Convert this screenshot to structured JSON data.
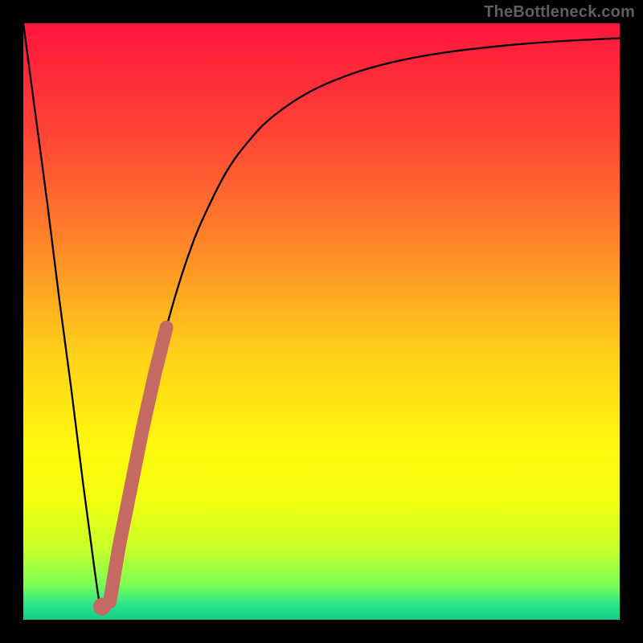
{
  "attribution": "TheBottleneck.com",
  "colors": {
    "frame": "#000000",
    "attribution_text": "#5f5f5f",
    "curve": "#000000",
    "overlay_stroke": "#c46a63",
    "gradient_stops": [
      {
        "offset": 0.0,
        "color": "#ff163d"
      },
      {
        "offset": 0.18,
        "color": "#ff4236"
      },
      {
        "offset": 0.35,
        "color": "#ff7e2b"
      },
      {
        "offset": 0.55,
        "color": "#ffcf1a"
      },
      {
        "offset": 0.7,
        "color": "#fff60e"
      },
      {
        "offset": 0.8,
        "color": "#f3ff0f"
      },
      {
        "offset": 0.88,
        "color": "#c8ff28"
      },
      {
        "offset": 0.94,
        "color": "#7eff54"
      },
      {
        "offset": 0.975,
        "color": "#28e58a"
      },
      {
        "offset": 1.0,
        "color": "#13cf86"
      }
    ]
  },
  "chart_data": {
    "type": "line",
    "title": "",
    "xlabel": "",
    "ylabel": "",
    "xlim": [
      0,
      100
    ],
    "ylim": [
      0,
      100
    ],
    "series": [
      {
        "name": "bottleneck-curve",
        "x": [
          0,
          2,
          4,
          6,
          8,
          10,
          12,
          13,
          14,
          16,
          18,
          20,
          22,
          24,
          26,
          28,
          30,
          34,
          38,
          42,
          48,
          55,
          62,
          70,
          80,
          90,
          100
        ],
        "y": [
          100,
          85,
          70,
          54,
          39,
          23,
          8,
          2,
          2,
          12,
          22,
          32,
          41,
          49,
          56,
          62,
          67,
          75,
          80.5,
          84.5,
          88.5,
          91.5,
          93.5,
          95,
          96.2,
          97,
          97.5
        ]
      },
      {
        "name": "highlight-segment",
        "x": [
          14.5,
          16,
          18,
          20,
          22,
          24
        ],
        "y": [
          3,
          12,
          22,
          32,
          41,
          49
        ]
      },
      {
        "name": "highlight-dot",
        "x": [
          13.2
        ],
        "y": [
          2.2
        ]
      }
    ]
  }
}
